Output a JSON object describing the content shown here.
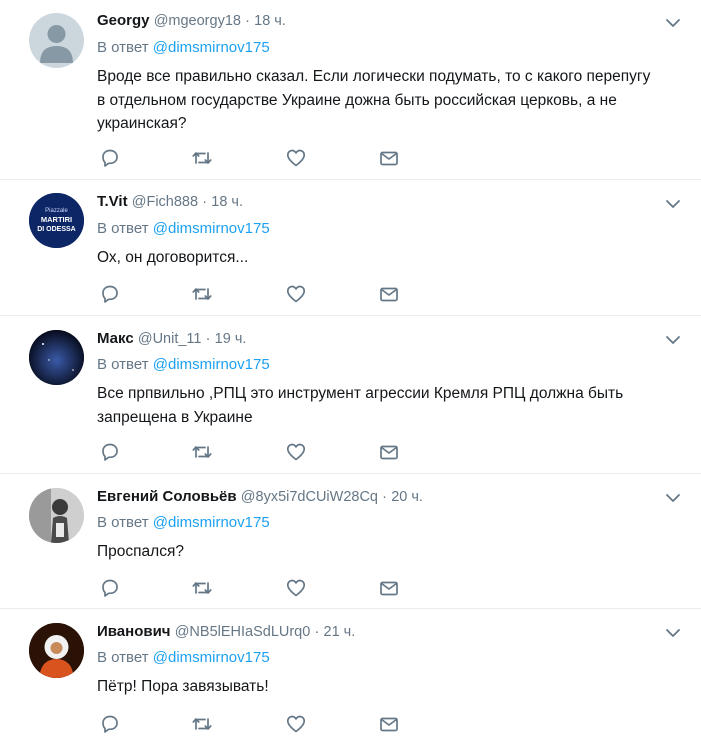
{
  "reply_prefix": "В ответ ",
  "tweets": [
    {
      "name": "Georgy",
      "handle": "@mgeorgy18",
      "dot": "·",
      "time": "18 ч.",
      "mention": "@dimsmirnov175",
      "text": "Вроде все правильно сказал. Если логически подумать, то с какого перепугу в отдельном государстве Украине дожна быть российская церковь, а не украинская?"
    },
    {
      "name": "T.Vit",
      "handle": "@Fich888",
      "dot": "·",
      "time": "18 ч.",
      "mention": "@dimsmirnov175",
      "text": "Ох, он договорится...",
      "avatar_text": [
        "Piazzale",
        "MARTIRI",
        "DI ODESSA"
      ]
    },
    {
      "name": "Макс",
      "handle": "@Unit_11",
      "dot": "·",
      "time": "19 ч.",
      "mention": "@dimsmirnov175",
      "text": "Все прпвильно ,РПЦ это инструмент агрессии Кремля РПЦ должна быть запрещена в Украине"
    },
    {
      "name": "Евгений Соловьёв",
      "handle": "@8yx5i7dCUiW28Cq",
      "dot": "·",
      "time": "20 ч.",
      "mention": "@dimsmirnov175",
      "text": "Проспался?"
    },
    {
      "name": "Иванович",
      "handle": "@NB5lEHIaSdLUrq0",
      "dot": "·",
      "time": "21 ч.",
      "mention": "@dimsmirnov175",
      "text": "Пётр! Пора завязывать!"
    }
  ],
  "colors": {
    "link": "#1da1f2",
    "muted": "#657786",
    "text": "#14171a",
    "divider": "#e6ecf0"
  }
}
